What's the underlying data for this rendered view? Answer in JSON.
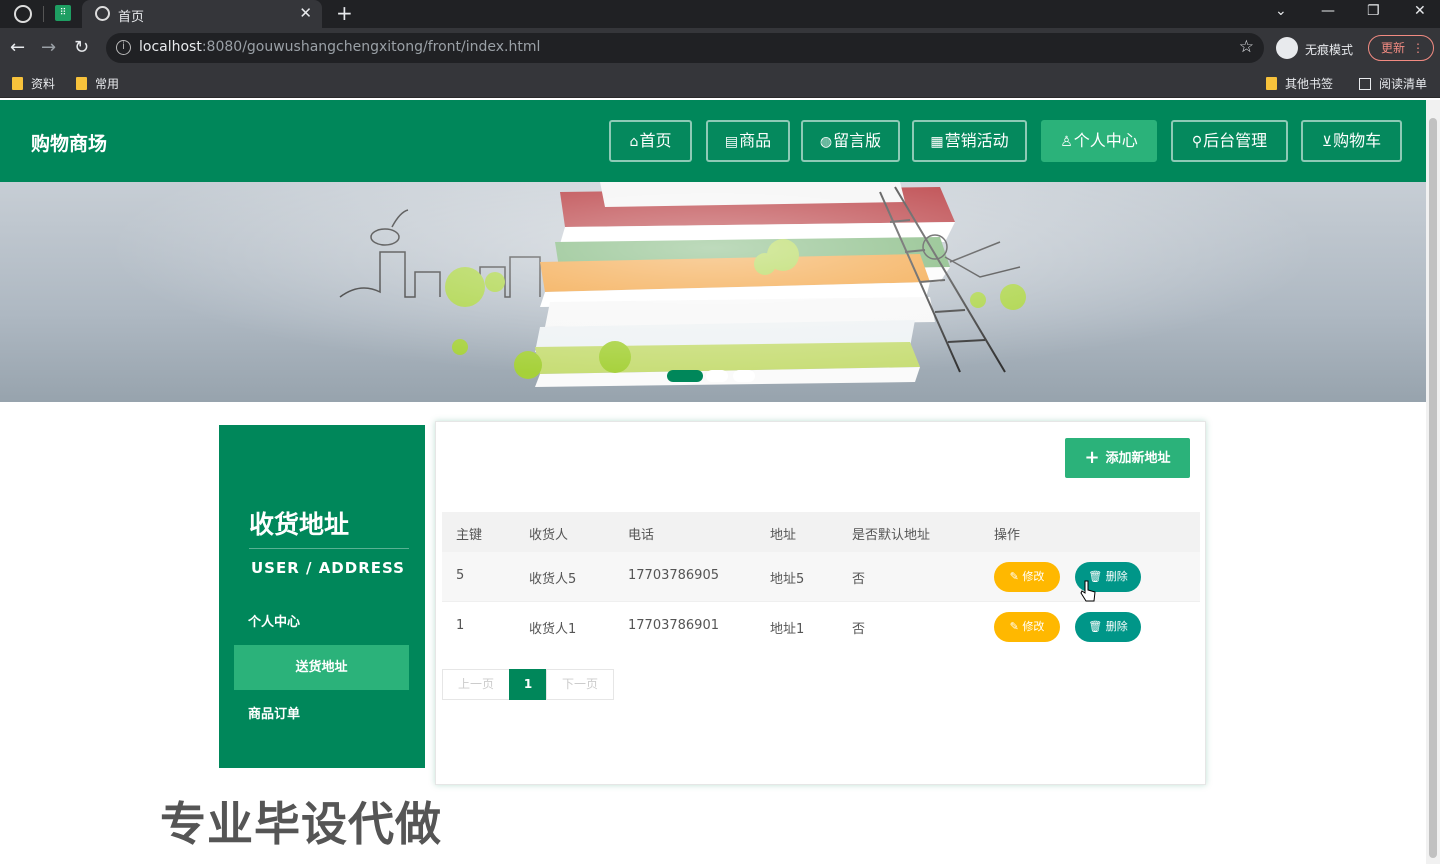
{
  "browser": {
    "tab_title": "首页",
    "url_host": "localhost",
    "url_rest": ":8080/gouwushangchengxitong/front/index.html",
    "incognito_label": "无痕模式",
    "update_label": "更新",
    "bookmarks": [
      "资料",
      "常用"
    ],
    "other_bookmarks": "其他书签",
    "reading_list": "阅读清单"
  },
  "site": {
    "title": "购物商场",
    "nav": [
      {
        "label": "首页",
        "icon": "home-icon"
      },
      {
        "label": "商品",
        "icon": "calendar-icon"
      },
      {
        "label": "留言版",
        "icon": "globe-icon"
      },
      {
        "label": "营销活动",
        "icon": "grid-icon"
      },
      {
        "label": "个人中心",
        "icon": "user-icon",
        "active": true
      },
      {
        "label": "后台管理",
        "icon": "link-icon"
      },
      {
        "label": "购物车",
        "icon": "cart-icon"
      }
    ]
  },
  "sidebar": {
    "title": "收货地址",
    "subtitle": "USER / ADDRESS",
    "items": [
      {
        "label": "个人中心"
      },
      {
        "label": "送货地址",
        "active": true
      },
      {
        "label": "商品订单"
      }
    ]
  },
  "main": {
    "add_button": "添加新地址",
    "table": {
      "headers": [
        "主键",
        "收货人",
        "电话",
        "地址",
        "是否默认地址",
        "操作"
      ],
      "rows": [
        {
          "id": "5",
          "name": "收货人5",
          "phone": "17703786905",
          "address": "地址5",
          "default": "否"
        },
        {
          "id": "1",
          "name": "收货人1",
          "phone": "17703786901",
          "address": "地址1",
          "default": "否"
        }
      ],
      "edit_label": "修改",
      "delete_label": "删除"
    },
    "pager": {
      "prev": "上一页",
      "current": "1",
      "next": "下一页"
    }
  },
  "watermark": "专业毕设代做",
  "colors": {
    "brand": "#00875a",
    "accent": "#2bb27a",
    "edit": "#ffb800",
    "delete": "#009688"
  }
}
